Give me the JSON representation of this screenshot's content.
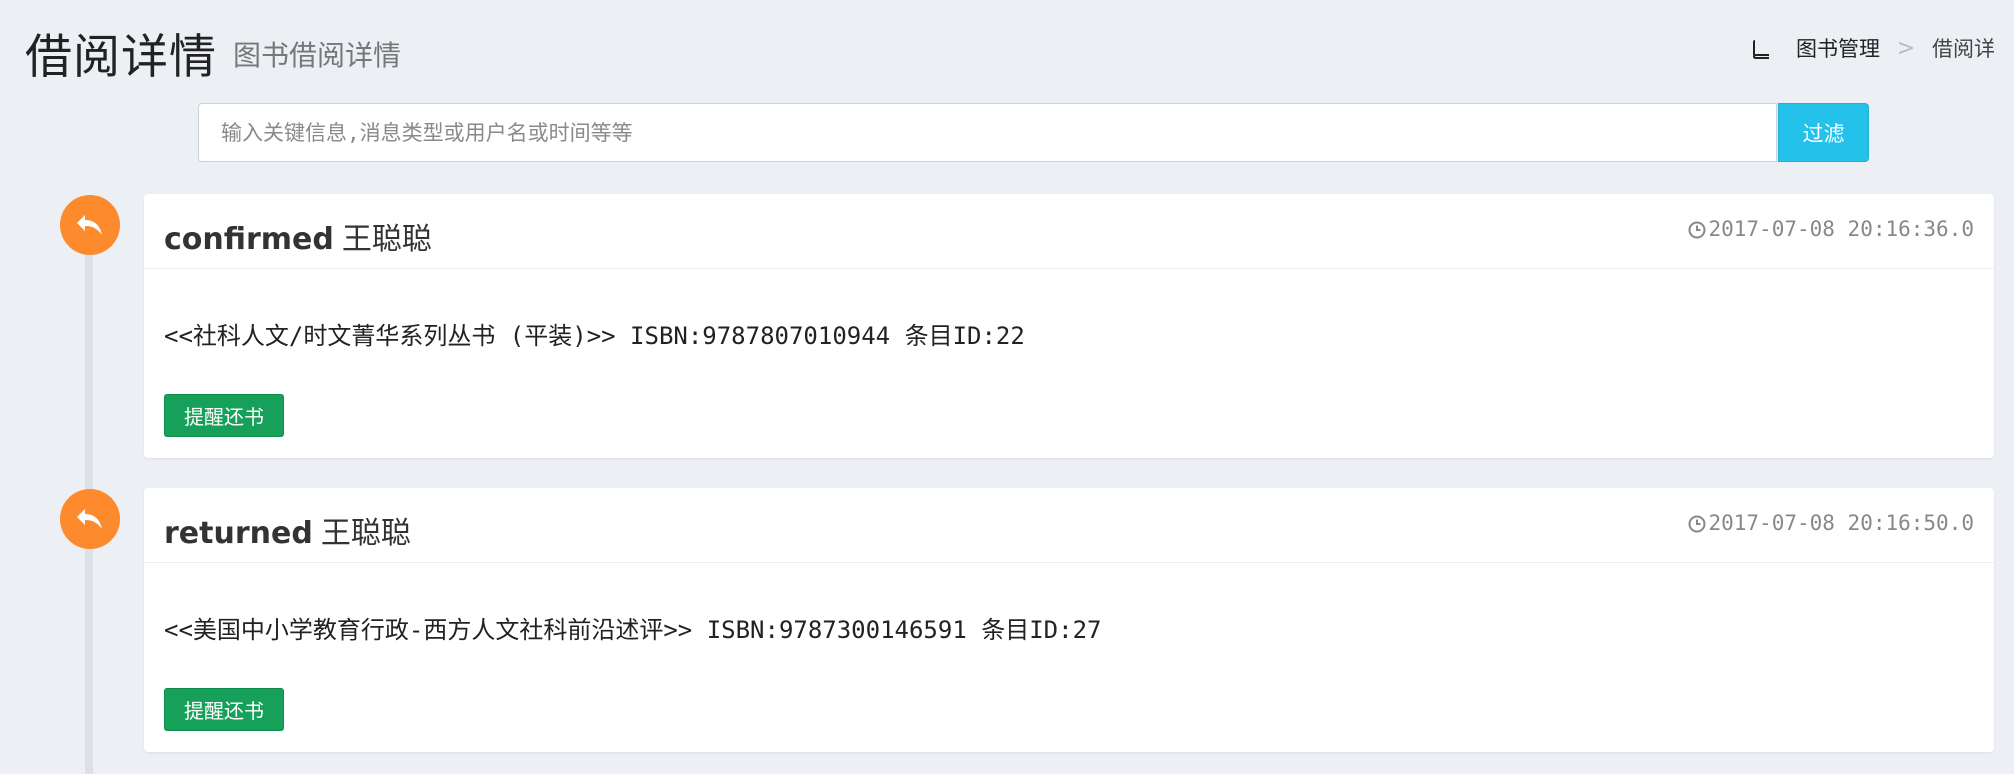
{
  "header": {
    "title": "借阅详情",
    "subtitle": "图书借阅详情",
    "breadcrumb": {
      "home_icon": "book-icon",
      "home_label": "图书管理",
      "separator": ">",
      "current_label": "借阅详"
    }
  },
  "filter": {
    "placeholder": "输入关键信息,消息类型或用户名或时间等等",
    "value": "",
    "button_label": "过滤"
  },
  "timeline": {
    "icon": "reply-icon",
    "icon_color": "#fd8a2d",
    "items": [
      {
        "status": "confirmed",
        "user": "王聪聪",
        "time_icon": "clock-icon",
        "time": "2017-07-08 20:16:36.0",
        "body": "<<社科人文/时文菁华系列丛书 (平装)>> ISBN:9787807010944 条目ID:22",
        "action_label": "提醒还书"
      },
      {
        "status": "returned",
        "user": "王聪聪",
        "time_icon": "clock-icon",
        "time": "2017-07-08 20:16:50.0",
        "body": "<<美国中小学教育行政-西方人文社科前沿述评>> ISBN:9787300146591 条目ID:27",
        "action_label": "提醒还书"
      }
    ]
  },
  "colors": {
    "background": "#ecf0f5",
    "primary_button": "#24c2ea",
    "success_button": "#16a05a",
    "timeline_icon": "#fd8a2d"
  }
}
